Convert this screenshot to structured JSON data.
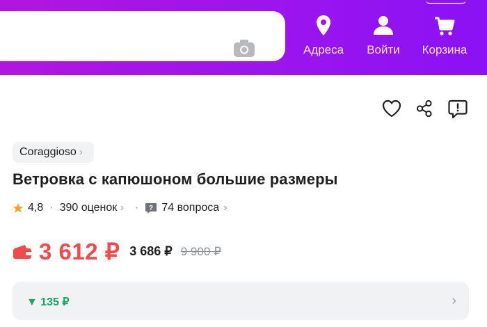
{
  "header": {
    "search": {
      "camera_icon": "camera-icon"
    },
    "nav": [
      {
        "label": "Адреса",
        "icon": "location-pin-icon"
      },
      {
        "label": "Войти",
        "icon": "user-icon"
      },
      {
        "label": "Корзина",
        "icon": "cart-icon"
      }
    ],
    "colors": {
      "gradient_start": "#b315e0",
      "gradient_end": "#8a12f4"
    }
  },
  "actions": [
    "heart-icon",
    "share-icon",
    "report-icon"
  ],
  "product": {
    "brand": "Coraggioso",
    "title": "Ветровка с капюшоном большие размеры",
    "rating": "4,8",
    "reviews": "390 оценок",
    "questions": "74 вопроса",
    "price": "3 612 ₽",
    "price_card": "3 686 ₽",
    "price_old": "9 900 ₽",
    "cashback": "135 ₽",
    "colors": {
      "price": "#f24a4a",
      "cashback": "#19a663",
      "star": "#f5a623"
    }
  }
}
